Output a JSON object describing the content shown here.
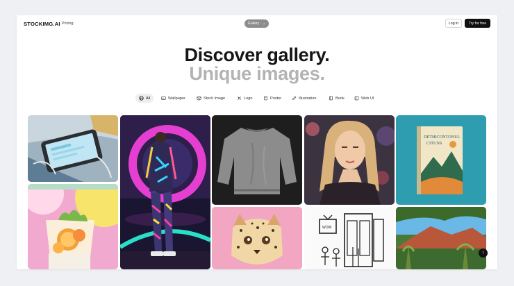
{
  "header": {
    "brand": "STOCKIMG.AI",
    "pricing": "Pricing",
    "gallery_pill": "Gallery",
    "login": "Log in",
    "try_free": "Try for free"
  },
  "hero": {
    "title": "Discover gallery.",
    "subtitle": "Unique images."
  },
  "tabs": [
    {
      "label": "All",
      "icon": "globe-icon",
      "active": true
    },
    {
      "label": "Wallpaper",
      "icon": "image-icon"
    },
    {
      "label": "Stock Image",
      "icon": "box-icon"
    },
    {
      "label": "Logo",
      "icon": "logo-icon"
    },
    {
      "label": "Poster",
      "icon": "poster-icon"
    },
    {
      "label": "Illustration",
      "icon": "pen-icon"
    },
    {
      "label": "Book",
      "icon": "book-icon"
    },
    {
      "label": "Web UI",
      "icon": "layout-icon"
    }
  ],
  "gallery": {
    "book_cover_text": [
      "DETHICONTONUL",
      "CITUNS"
    ],
    "scroll_top_icon": "arrow-up-icon"
  }
}
